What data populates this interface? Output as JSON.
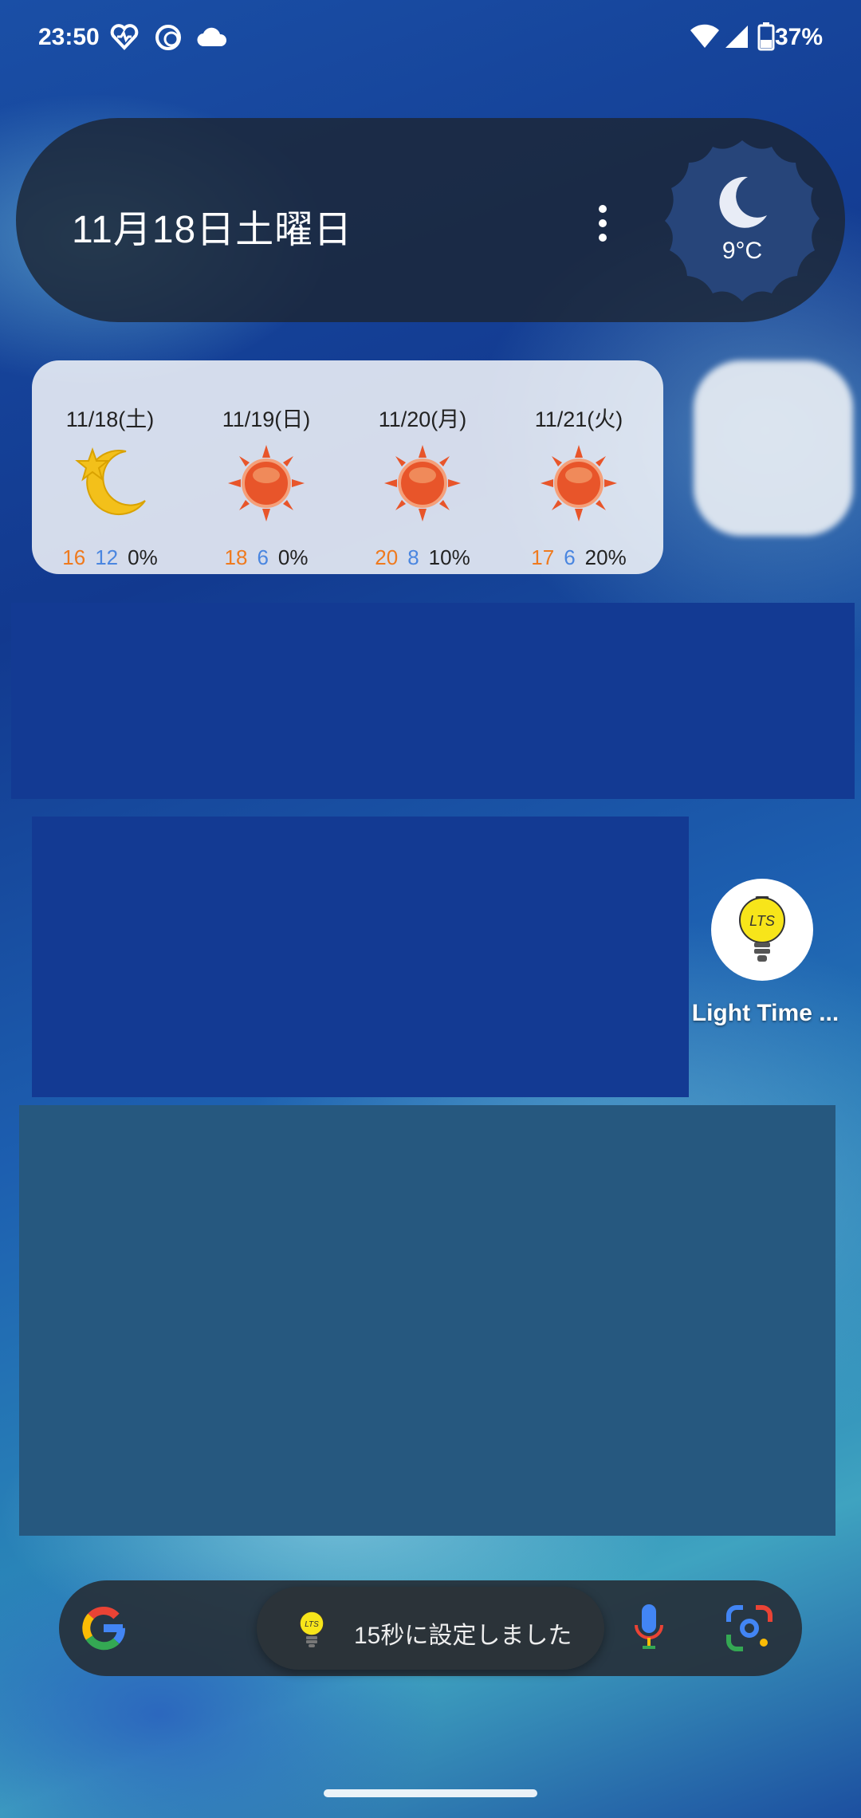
{
  "status_bar": {
    "time": "23:50",
    "battery": "37%",
    "icons": [
      "heart-pulse-icon",
      "sync-icon",
      "cloud-icon",
      "wifi-icon",
      "signal-icon",
      "battery-icon"
    ]
  },
  "date_widget": {
    "date": "11月18日土曜日",
    "current_temp": "9°C",
    "condition_icon": "moon-icon"
  },
  "forecast": {
    "days": [
      {
        "date": "11/18(土)",
        "icon": "moon-star-icon",
        "high": "16",
        "low": "12",
        "pop": "0%"
      },
      {
        "date": "11/19(日)",
        "icon": "sun-icon",
        "high": "18",
        "low": "6",
        "pop": "0%"
      },
      {
        "date": "11/20(月)",
        "icon": "sun-icon",
        "high": "20",
        "low": "8",
        "pop": "10%"
      },
      {
        "date": "11/21(火)",
        "icon": "sun-icon",
        "high": "17",
        "low": "6",
        "pop": "20%"
      }
    ]
  },
  "app": {
    "label": "Light Time ...",
    "icon_text": "LTS"
  },
  "search_bar": {
    "toast_text": "15秒に設定しました"
  },
  "colors": {
    "high_temp": "#ef7a1e",
    "low_temp": "#4a86e0"
  }
}
